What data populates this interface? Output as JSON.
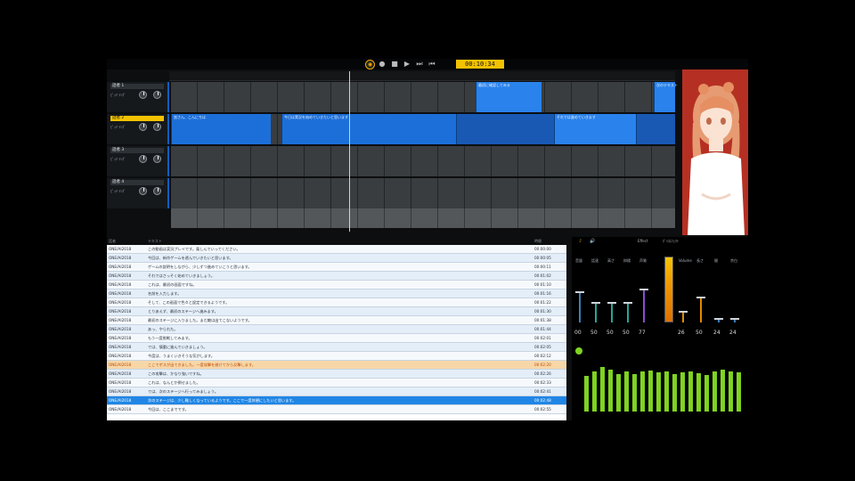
{
  "transport": {
    "buttons": [
      "◉",
      "●",
      "■",
      "▶",
      "⏭",
      "⏮"
    ],
    "timecode": "00:10:34"
  },
  "tracks": [
    {
      "name": "話者 1",
      "active": false,
      "hint": "ﾋﾟｯﾁ ﾃﾝﾎﾟ"
    },
    {
      "name": "話者 2",
      "active": true,
      "hint": "ﾋﾟｯﾁ ﾃﾝﾎﾟ"
    },
    {
      "name": "話者 3",
      "active": false,
      "hint": "ﾋﾟｯﾁ ﾃﾝﾎﾟ"
    },
    {
      "name": "話者 4",
      "active": false,
      "hint": "ﾋﾟｯﾁ ﾃﾝﾎﾟ"
    }
  ],
  "clips": {
    "track1": [
      {
        "label": "最初に確認してみる",
        "style": "lite"
      },
      {
        "label": "次のテキスト",
        "style": "lite"
      }
    ],
    "track2": [
      {
        "label": "皆さん、こんにちは",
        "style": "normal"
      },
      {
        "label": "今日は実況を始めていきたいと思います",
        "style": "normal"
      },
      {
        "label": "",
        "style": "dark"
      },
      {
        "label": "それでは進めていきます",
        "style": "lite"
      }
    ]
  },
  "list": {
    "headers": [
      "話者",
      "テキスト",
      "時間"
    ],
    "rows": [
      {
        "speaker": "ONE/AI2018",
        "text": "この動画は実況プレイです。楽しんでいってください。",
        "time": "00:00:00",
        "state": "odd"
      },
      {
        "speaker": "ONE/AI2018",
        "text": "今回は、新作ゲームを遊んでいきたいと思います。",
        "time": "00:00:05",
        "state": "even"
      },
      {
        "speaker": "ONE/AI2018",
        "text": "ゲームの説明をしながら、少しずつ進めていこうと思います。",
        "time": "00:00:11",
        "state": "odd"
      },
      {
        "speaker": "ONE/AI2018",
        "text": "それではさっそく始めていきましょう。",
        "time": "00:01:02",
        "state": "even"
      },
      {
        "speaker": "ONE/AI2018",
        "text": "これは、最初の画面ですね。",
        "time": "00:01:10",
        "state": "odd"
      },
      {
        "speaker": "ONE/AI2018",
        "text": "名前を入力します。",
        "time": "00:01:16",
        "state": "even"
      },
      {
        "speaker": "ONE/AI2018",
        "text": "そして、この画面で色々と設定できるようです。",
        "time": "00:01:22",
        "state": "odd"
      },
      {
        "speaker": "ONE/AI2018",
        "text": "とりあえず、最初のステージへ進みます。",
        "time": "00:01:30",
        "state": "even"
      },
      {
        "speaker": "ONE/AI2018",
        "text": "最初のステージに入りました。まだ敵は出てこないようです。",
        "time": "00:01:38",
        "state": "odd"
      },
      {
        "speaker": "ONE/AI2018",
        "text": "あっ、やられた。",
        "time": "00:01:44",
        "state": "even"
      },
      {
        "speaker": "ONE/AI2018",
        "text": "もう一度挑戦してみます。",
        "time": "00:02:01",
        "state": "odd"
      },
      {
        "speaker": "ONE/AI2018",
        "text": "では、慎重に進んでいきましょう。",
        "time": "00:02:05",
        "state": "even"
      },
      {
        "speaker": "ONE/AI2018",
        "text": "今度は、うまくいきそうな気がします。",
        "time": "00:02:12",
        "state": "odd"
      },
      {
        "speaker": "ONE/AI2018",
        "text": "ここでボスが出てきました。一度攻撃を避けてから反撃します。",
        "time": "00:02:20",
        "state": "hl"
      },
      {
        "speaker": "ONE/AI2018",
        "text": "この攻撃は、かなり強いですね。",
        "time": "00:02:26",
        "state": "even"
      },
      {
        "speaker": "ONE/AI2018",
        "text": "これは、なんとか倒せました。",
        "time": "00:02:33",
        "state": "odd"
      },
      {
        "speaker": "ONE/AI2018",
        "text": "では、次のステージへ行ってみましょう。",
        "time": "00:02:41",
        "state": "even"
      },
      {
        "speaker": "ONE/AI2018",
        "text": "次のステージは、少し難しくなっているようです。ここで一度休憩にしたいと思います。",
        "time": "00:02:48",
        "state": "sel"
      },
      {
        "speaker": "ONE/AI2018",
        "text": "今回は、ここまでです。",
        "time": "00:02:55",
        "state": "odd"
      }
    ]
  },
  "mixer": {
    "header_labels": [
      "Effect",
      "ﾎﾞｲｽｴﾌｪｸﾄ"
    ],
    "channel_labels": [
      "音量",
      "話速",
      "高さ",
      "抑揚",
      "声質",
      "Volume",
      "長さ",
      "間",
      "余白",
      "声"
    ],
    "values": [
      "00",
      "50",
      "50",
      "50",
      "77",
      "26",
      "50",
      "24",
      "24"
    ],
    "fader_levels": [
      0.55,
      0.35,
      0.35,
      0.35,
      0.6,
      0.2,
      0.45,
      0.05,
      0.05
    ],
    "eq_levels": [
      0.8,
      0.9,
      1.0,
      0.95,
      0.85,
      0.9,
      0.85,
      0.9,
      0.92,
      0.88,
      0.9,
      0.85,
      0.88,
      0.9,
      0.86,
      0.82,
      0.9,
      0.95,
      0.9,
      0.88
    ],
    "colors": {
      "accent": "#f2c200",
      "eq": "#7ed321",
      "fader": "#3b7db8"
    }
  }
}
